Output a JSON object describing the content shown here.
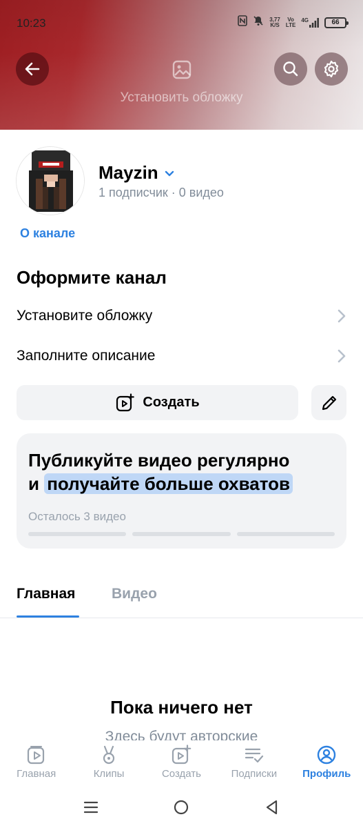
{
  "status": {
    "time": "10:23",
    "speed_value": "3,77",
    "speed_unit": "K/S",
    "volte_top": "Vo",
    "volte_bottom": "LTE",
    "network": "4G",
    "battery": "66"
  },
  "header": {
    "cover_label": "Установить обложку",
    "icons": [
      "arrow-left-icon",
      "image-icon",
      "search-icon",
      "gear-icon"
    ]
  },
  "channel": {
    "name": "Mayzin",
    "stats": "1 подписчик · 0 видео",
    "about_link": "О канале"
  },
  "setup": {
    "title": "Оформите канал",
    "items": [
      {
        "label": "Установите обложку"
      },
      {
        "label": "Заполните описание"
      }
    ]
  },
  "actions": {
    "create_label": "Создать"
  },
  "promo": {
    "title_line1": "Публикуйте видео регулярно",
    "title_line2_prefix": "и",
    "title_line2_highlight": "получайте больше охватов",
    "remaining": "Осталось 3 видео",
    "progress_done": 0,
    "progress_total": 3
  },
  "tabs": [
    {
      "label": "Главная",
      "active": true
    },
    {
      "label": "Видео",
      "active": false
    }
  ],
  "empty_state": {
    "title": "Пока ничего нет",
    "subtitle": "Здесь будут авторские"
  },
  "bottom_nav": [
    {
      "label": "Главная",
      "icon": "play-square-icon",
      "active": false
    },
    {
      "label": "Клипы",
      "icon": "clips-icon",
      "active": false
    },
    {
      "label": "Создать",
      "icon": "add-video-icon",
      "active": false
    },
    {
      "label": "Подписки",
      "icon": "subscriptions-icon",
      "active": false
    },
    {
      "label": "Профиль",
      "icon": "profile-icon",
      "active": true
    }
  ],
  "colors": {
    "accent": "#2d81e0",
    "secondary_text": "#818c99",
    "card_bg": "#f2f3f5",
    "highlight": "#bfd7f6"
  }
}
